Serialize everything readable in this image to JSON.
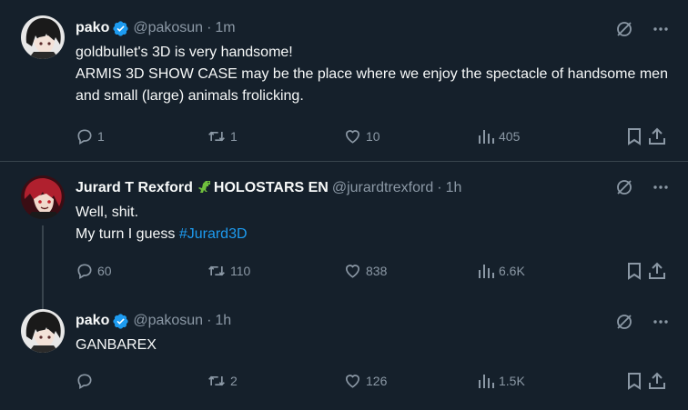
{
  "tweets": [
    {
      "name": "pako",
      "handle": "@pakosun",
      "time": "1m",
      "lines": [
        "goldbullet's 3D is very handsome!",
        "ARMIS 3D SHOW CASE may be the place where we enjoy the spectacle of handsome men and small (large) animals frolicking."
      ],
      "replies": "1",
      "retweets": "1",
      "likes": "10",
      "views": "405"
    },
    {
      "name": "Jurard T Rexford",
      "name_suffix": "HOLOSTARS EN",
      "handle": "@jurardtrexford",
      "time": "1h",
      "line1": "Well, shit.",
      "line2_prefix": "My turn I guess ",
      "hashtag": "#Jurard3D",
      "replies": "60",
      "retweets": "110",
      "likes": "838",
      "views": "6.6K"
    },
    {
      "name": "pako",
      "handle": "@pakosun",
      "time": "1h",
      "text": "GANBAREX",
      "replies": "",
      "retweets": "2",
      "likes": "126",
      "views": "1.5K"
    }
  ],
  "separator": "·",
  "colors": {
    "background": "#15202b",
    "muted": "#8b98a5",
    "accent": "#1d9bf0",
    "border": "#38444d"
  },
  "icons": [
    "verified-badge-icon",
    "grok-icon",
    "more-icon",
    "reply-icon",
    "retweet-icon",
    "like-icon",
    "views-icon",
    "bookmark-icon",
    "share-icon",
    "dinosaur-icon"
  ]
}
